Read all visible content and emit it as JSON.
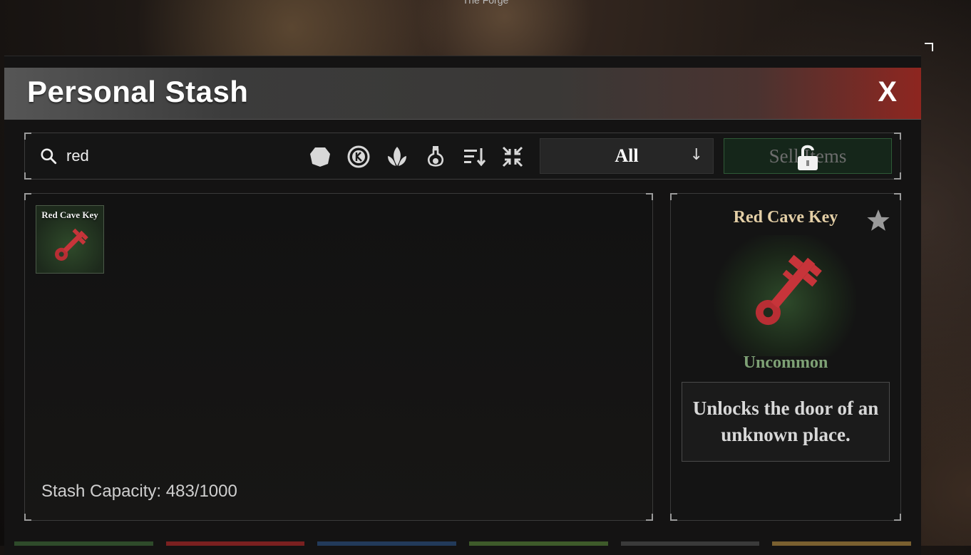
{
  "background": {
    "caption": "The Forge"
  },
  "window": {
    "title": "Personal Stash",
    "close_label": "X"
  },
  "toolbar": {
    "search_value": "red",
    "filter_icons": [
      "gem-filter-icon",
      "currency-filter-icon",
      "herb-filter-icon",
      "potion-filter-icon",
      "sort-icon",
      "collapse-icon"
    ],
    "category_select": "All",
    "sell_label": "Sell Items"
  },
  "grid": {
    "items": [
      {
        "label": "Red Cave Key"
      }
    ],
    "capacity": "Stash Capacity: 483/1000"
  },
  "detail": {
    "name": "Red Cave Key",
    "rarity": "Uncommon",
    "description": "Unlocks the door of an unknown place."
  },
  "colors": {
    "title_accent": "#8e2620",
    "item_name": "#e4cfa6",
    "rarity_uncommon": "#7ea175",
    "key_red": "#c7343a",
    "sell_border": "#2f5a37"
  }
}
